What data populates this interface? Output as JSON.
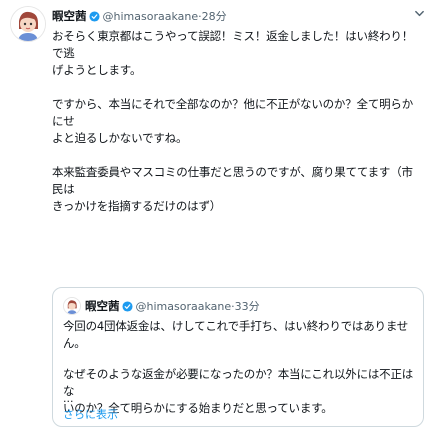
{
  "tweet": {
    "author_name": "暇空茜",
    "handle": "@himasoraakane",
    "separator": "·",
    "time": "28分",
    "paragraphs": [
      "おそらく東京都はこうやって誤認！ミス！返金しました！はい終わり！で逃\nげようとします。",
      "ですから、本当にそれで全部なのか？他に不正がないのか？全て明らかにせ\nよと迫るしかないですね。",
      "本来監査委員やマスコミの仕事だと思うのですが、腐り果ててます（市民は\nきっかけを指摘するだけのはず）"
    ]
  },
  "quote": {
    "author_name": "暇空茜",
    "handle": "@himasoraakane",
    "separator": "·",
    "time": "33分",
    "paragraphs": [
      "今回の4団体返金は、けしてこれで手打ち、はい終わりではありません。",
      "なぜそのような返金が必要になったのか？本当にこれ以外には不正はな\nいのか？全て明らかにする始まりだと思っています。"
    ],
    "ellipsis": "...",
    "show_more": "さらに表示"
  },
  "colors": {
    "verified": "#1d9bf0",
    "link": "#1d9bf0",
    "muted": "#536471"
  },
  "icons": {
    "verified": "verified-badge-icon",
    "menu": "chevron-down-icon",
    "avatar": "avatar-illustration"
  }
}
